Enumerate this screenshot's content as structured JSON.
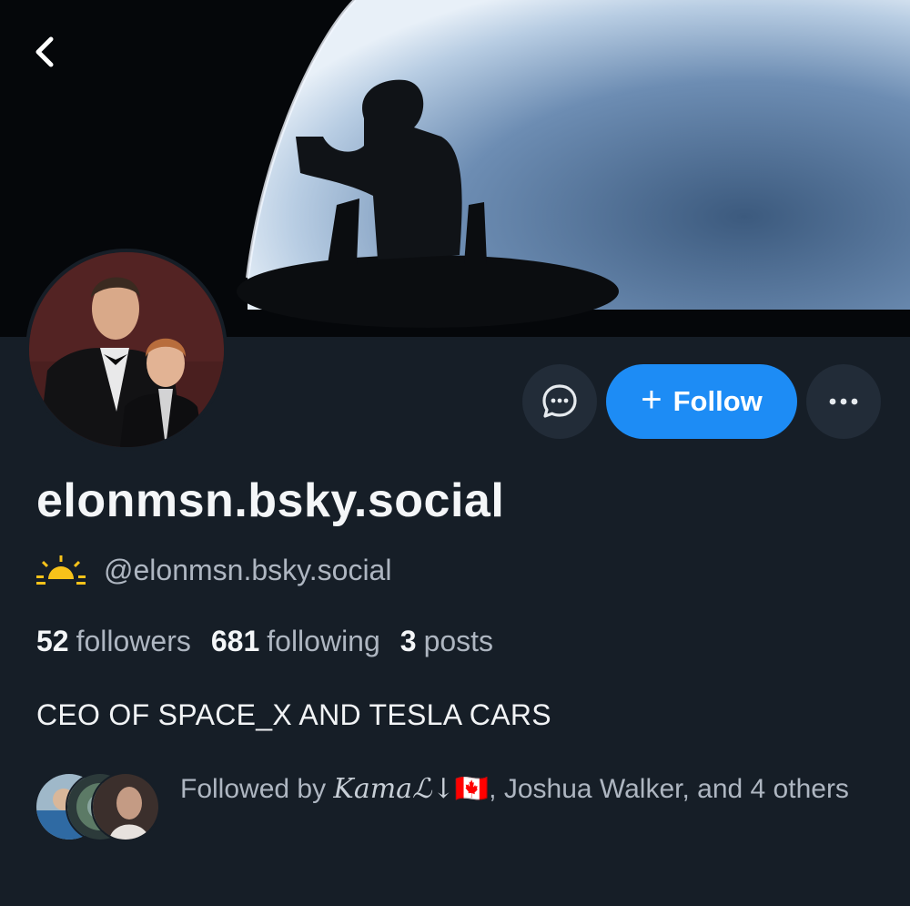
{
  "header": {
    "back_icon": "chevron-left-icon"
  },
  "profile": {
    "display_name": "elonmsn.bsky.social",
    "handle_emoji": "sunrise-icon",
    "handle": "@elonmsn.bsky.social",
    "bio": "CEO OF SPACE_X AND TESLA CARS"
  },
  "actions": {
    "message_icon": "chat-bubble-icon",
    "follow_label": "Follow",
    "more_icon": "ellipsis-icon"
  },
  "stats": {
    "followers_count": "52",
    "followers_label": "followers",
    "following_count": "681",
    "following_label": "following",
    "posts_count": "3",
    "posts_label": "posts"
  },
  "followed_by": {
    "prefix": "Followed by",
    "first_name": "𝐾𝑎𝑚𝑎ℒ↓",
    "first_flag": "🇨🇦",
    "rest": ", Joshua Walker, and 4 others"
  },
  "colors": {
    "accent": "#1d8cf5",
    "background": "#161e27",
    "button_bg": "#222c38"
  }
}
